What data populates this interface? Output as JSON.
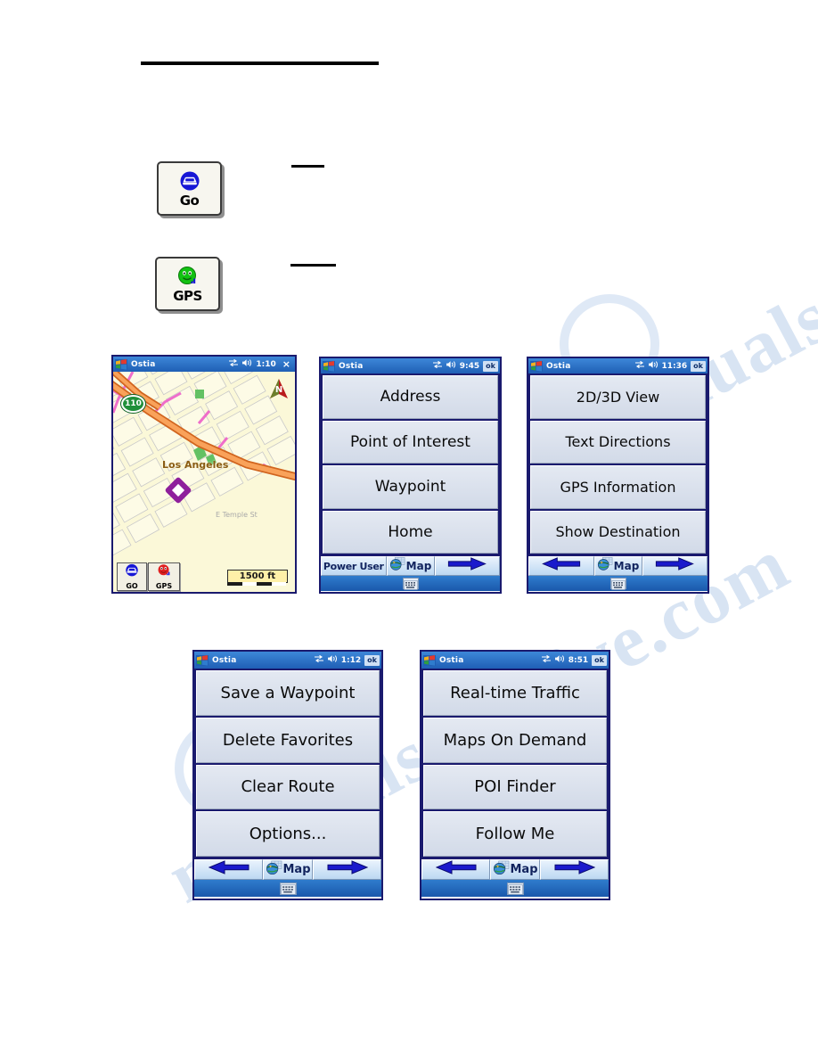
{
  "page": {
    "background_color": "#ffffff",
    "watermark_text": "manualsarchive.com"
  },
  "legend": {
    "items": [
      {
        "icon": "go-car-icon",
        "label": "Go",
        "description_rule": "—"
      },
      {
        "icon": "gps-satellite-icon",
        "label": "GPS",
        "description_rule": "—"
      }
    ]
  },
  "screens": [
    {
      "id": "map-screen",
      "type": "map",
      "titlebar": {
        "start_icon": "windows-flag-icon",
        "app": "Ostia",
        "connectivity_icon": "connectivity-icon",
        "volume_icon": "speaker-icon",
        "time": "1:10",
        "close_label": "×"
      },
      "map": {
        "highway_shield": "110",
        "city_label": "Los Angeles",
        "street_label": "E Temple St",
        "compass_label": "N",
        "scale_label": "1500 ft",
        "waypoint_marker": "destination-diamond-icon"
      },
      "map_buttons": [
        {
          "icon": "go-car-icon",
          "label": "GO"
        },
        {
          "icon": "gps-satellite-icon",
          "label": "GPS"
        }
      ]
    },
    {
      "id": "destination-menu",
      "type": "menu",
      "titlebar": {
        "start_icon": "windows-flag-icon",
        "app": "Ostia",
        "connectivity_icon": "connectivity-icon",
        "volume_icon": "speaker-icon",
        "time": "9:45",
        "close_label": "ok"
      },
      "buttons": [
        "Address",
        "Point of Interest",
        "Waypoint",
        "Home"
      ],
      "cmdbar": {
        "left_kind": "text",
        "left_label": "Power User",
        "map_label": "Map",
        "right_kind": "arrow-right",
        "sip_icon": "keyboard-icon"
      }
    },
    {
      "id": "view-menu",
      "type": "menu",
      "titlebar": {
        "start_icon": "windows-flag-icon",
        "app": "Ostia",
        "connectivity_icon": "connectivity-icon",
        "volume_icon": "speaker-icon",
        "time": "11:36",
        "close_label": "ok"
      },
      "buttons": [
        "2D/3D View",
        "Text Directions",
        "GPS Information",
        "Show Destination"
      ],
      "cmdbar": {
        "left_kind": "arrow-left",
        "left_label": "",
        "map_label": "Map",
        "right_kind": "arrow-right",
        "sip_icon": "keyboard-icon"
      }
    },
    {
      "id": "waypoint-menu",
      "type": "menu",
      "titlebar": {
        "start_icon": "windows-flag-icon",
        "app": "Ostia",
        "connectivity_icon": "connectivity-icon",
        "volume_icon": "speaker-icon",
        "time": "1:12",
        "close_label": "ok"
      },
      "buttons": [
        "Save a Waypoint",
        "Delete Favorites",
        "Clear Route",
        "Options..."
      ],
      "cmdbar": {
        "left_kind": "arrow-left",
        "left_label": "",
        "map_label": "Map",
        "right_kind": "arrow-right",
        "sip_icon": "keyboard-icon"
      }
    },
    {
      "id": "services-menu",
      "type": "menu",
      "titlebar": {
        "start_icon": "windows-flag-icon",
        "app": "Ostia",
        "connectivity_icon": "connectivity-icon",
        "volume_icon": "speaker-icon",
        "time": "8:51",
        "close_label": "ok"
      },
      "buttons": [
        "Real-time Traffic",
        "Maps On Demand",
        "POI Finder",
        "Follow Me"
      ],
      "cmdbar": {
        "left_kind": "arrow-left",
        "left_label": "",
        "map_label": "Map",
        "right_kind": "arrow-right",
        "sip_icon": "keyboard-icon"
      }
    }
  ],
  "colors": {
    "device_border": "#1a1a6e",
    "titlebar_blue": "#2f7ccd",
    "button_face": "#dde4ee",
    "arrow_blue": "#1a1acc",
    "map_land": "#fbf8d8",
    "highway_orange": "#f08a3c",
    "highway_pink": "#ee5fc8",
    "shield_green": "#1f8f3a",
    "scale_yellow": "#fff0a8"
  }
}
